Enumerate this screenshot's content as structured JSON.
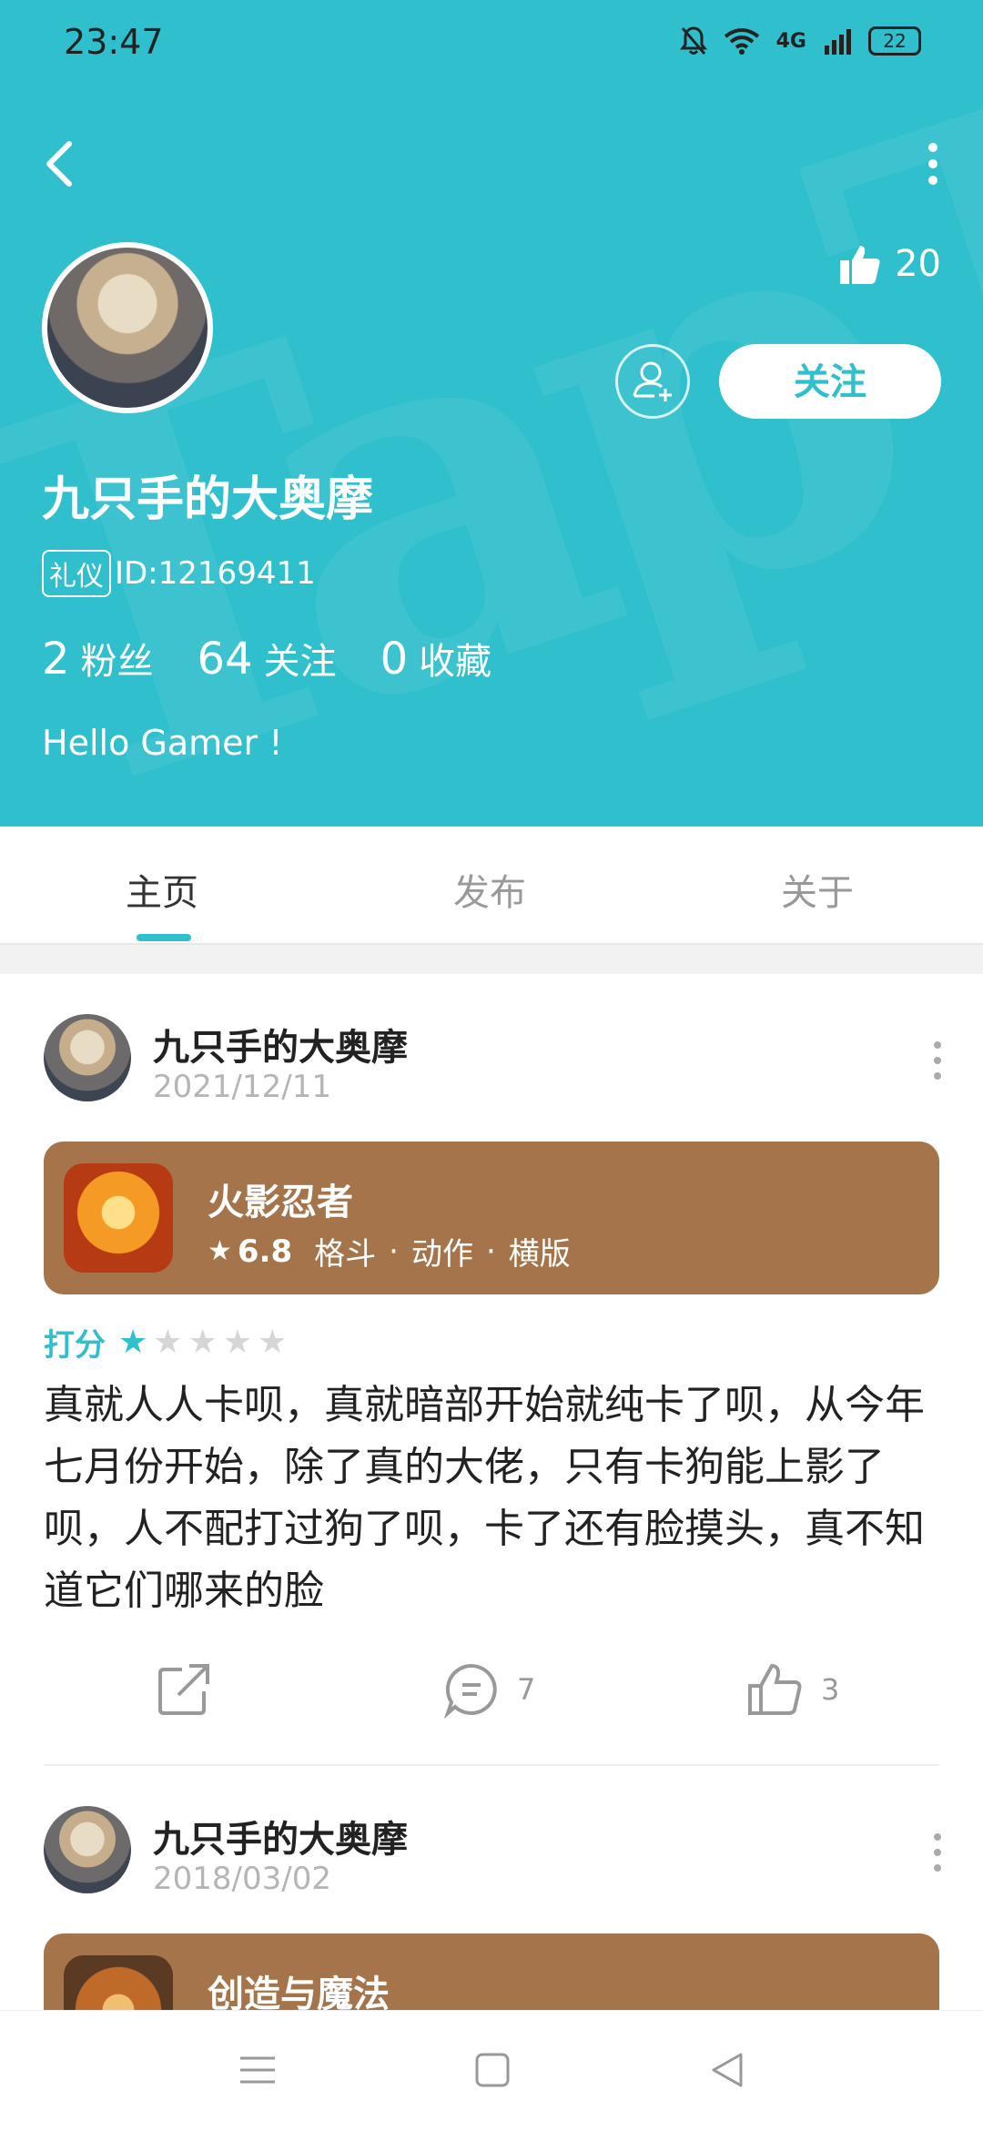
{
  "status_bar": {
    "time": "23:47",
    "network": "4G",
    "battery": "22"
  },
  "profile": {
    "likes": "20",
    "follow_label": "关注",
    "name": "九只手的大奥摩",
    "id_tag": "礼仪",
    "id_text": "ID:12169411",
    "stats": [
      {
        "value": "2",
        "label": "粉丝"
      },
      {
        "value": "64",
        "label": "关注"
      },
      {
        "value": "0",
        "label": "收藏"
      }
    ],
    "bio": "Hello Gamer !"
  },
  "tabs": [
    {
      "label": "主页"
    },
    {
      "label": "发布"
    },
    {
      "label": "关于"
    }
  ],
  "active_tab": "主页",
  "posts": [
    {
      "author": "九只手的大奥摩",
      "date": "2021/12/11",
      "game": {
        "title": "火影忍者",
        "score": "6.8",
        "tags": [
          "格斗",
          "动作",
          "横版"
        ]
      },
      "rating_label": "打分",
      "rating": 1,
      "rating_max": 5,
      "text": "真就人人卡呗，真就暗部开始就纯卡了呗，从今年七月份开始，除了真的大佬，只有卡狗能上影了呗，人不配打过狗了呗，卡了还有脸摸头，真不知道它们哪来的脸",
      "comments": "7",
      "likes": "3"
    },
    {
      "author": "九只手的大奥摩",
      "date": "2018/03/02",
      "game": {
        "title": "创造与魔法"
      }
    }
  ],
  "colors": {
    "accent": "#2fbfcd",
    "card_brown": "#a5744a"
  }
}
